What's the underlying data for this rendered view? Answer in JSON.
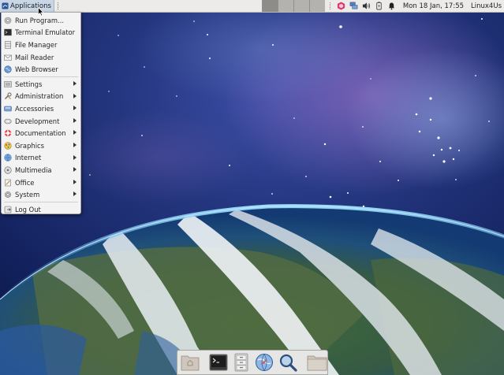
{
  "panel": {
    "applications_label": "Applications",
    "clock": "Mon 18 Jan, 17:55",
    "user": "Linux4Us",
    "workspaces": 4,
    "active_workspace": 1,
    "tray_icons": [
      "bug-report-icon",
      "network-icon",
      "volume-icon",
      "battery-icon",
      "notification-bell-icon"
    ]
  },
  "menu": {
    "items": [
      {
        "label": "Run Program...",
        "icon": "run-program-icon"
      },
      {
        "label": "Terminal Emulator",
        "icon": "terminal-icon"
      },
      {
        "label": "File Manager",
        "icon": "file-manager-icon"
      },
      {
        "label": "Mail Reader",
        "icon": "mail-icon"
      },
      {
        "label": "Web Browser",
        "icon": "web-browser-icon"
      },
      {
        "label": "Settings",
        "icon": "settings-icon",
        "submenu": true
      },
      {
        "label": "Administration",
        "icon": "administration-icon",
        "submenu": true
      },
      {
        "label": "Accessories",
        "icon": "accessories-icon",
        "submenu": true
      },
      {
        "label": "Development",
        "icon": "development-icon",
        "submenu": true
      },
      {
        "label": "Documentation",
        "icon": "documentation-icon",
        "submenu": true
      },
      {
        "label": "Graphics",
        "icon": "graphics-icon",
        "submenu": true
      },
      {
        "label": "Internet",
        "icon": "internet-icon",
        "submenu": true
      },
      {
        "label": "Multimedia",
        "icon": "multimedia-icon",
        "submenu": true
      },
      {
        "label": "Office",
        "icon": "office-icon",
        "submenu": true
      },
      {
        "label": "System",
        "icon": "system-icon",
        "submenu": true
      },
      {
        "label": "Log Out",
        "icon": "log-out-icon"
      }
    ]
  },
  "dock": {
    "items": [
      "show-desktop-icon",
      "terminal-icon",
      "file-manager-icon",
      "web-browser-icon",
      "search-icon",
      "home-folder-icon"
    ]
  },
  "colors": {
    "panel_bg": "#ecebea",
    "menu_bg": "#f3f3f3",
    "apps_button_bg": "#c8d6e6",
    "sky": "#1b2f78",
    "nebula": "#6b4fa0"
  }
}
